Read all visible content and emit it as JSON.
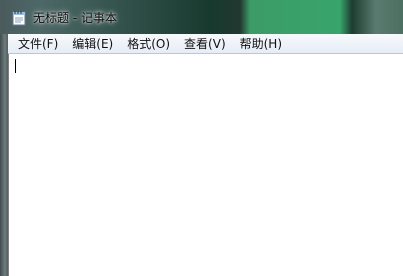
{
  "window": {
    "title": "无标题 - 记事本",
    "app_icon": "notepad-icon"
  },
  "menubar": {
    "items": [
      {
        "label": "文件(F)"
      },
      {
        "label": "编辑(E)"
      },
      {
        "label": "格式(O)"
      },
      {
        "label": "查看(V)"
      },
      {
        "label": "帮助(H)"
      }
    ]
  },
  "editor": {
    "content": ""
  },
  "colors": {
    "menubar_background": "#eef3fa",
    "editor_background": "#ffffff",
    "desktop_accent": "#3aa36a"
  }
}
